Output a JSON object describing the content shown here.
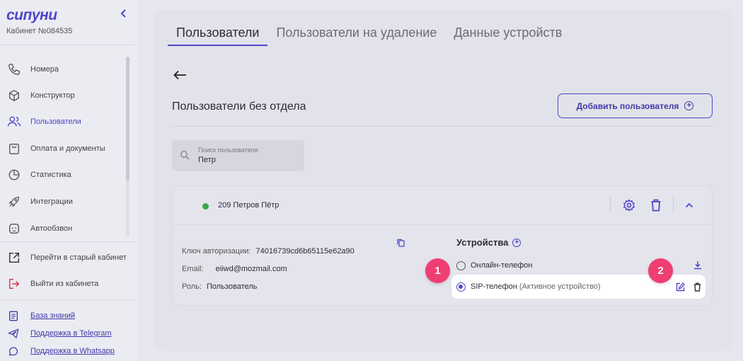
{
  "sidebar": {
    "logo": "сипуни",
    "cabinet": "Кабинет №084535",
    "items": [
      {
        "label": "Номера",
        "icon": "phone-icon"
      },
      {
        "label": "Конструктор",
        "icon": "cube-icon"
      },
      {
        "label": "Пользователи",
        "icon": "users-icon",
        "active": true
      },
      {
        "label": "Оплата и документы",
        "icon": "bag-icon"
      },
      {
        "label": "Статистика",
        "icon": "pie-chart-icon"
      },
      {
        "label": "Интеграции",
        "icon": "rocket-icon"
      },
      {
        "label": "Автообзвон",
        "icon": "robot-icon"
      }
    ],
    "old_cabinet": "Перейти в старый кабинет",
    "logout": "Выйти из кабинета",
    "links": [
      {
        "label": "База знаний",
        "icon": "clipboard-icon"
      },
      {
        "label": "Поддержка в Telegram",
        "icon": "telegram-icon"
      },
      {
        "label": "Поддержка в Whatsapp",
        "icon": "whatsapp-icon"
      }
    ]
  },
  "tabs": [
    {
      "label": "Пользователи",
      "active": true
    },
    {
      "label": "Пользователи на удаление"
    },
    {
      "label": "Данные устройств"
    }
  ],
  "page": {
    "title": "Пользователи без отдела",
    "add_button": "Добавить пользователя"
  },
  "search": {
    "placeholder": "Поиск пользователя",
    "value": "Петр"
  },
  "user": {
    "name": "209 Петров Пётр",
    "status": "online",
    "auth_key_label": "Ключ авторизации:",
    "auth_key": "74016739cd6b65115e62a90",
    "email_label": "Email:",
    "email": "eiiwd@mozmail.com",
    "role_label": "Роль:",
    "role": "Пользователь"
  },
  "devices": {
    "title": "Устройства",
    "list": [
      {
        "name": "Онлайн-телефон",
        "note": "",
        "selected": false
      },
      {
        "name": "SIP-телефон",
        "note": "(Активное устройство)",
        "selected": true
      }
    ]
  },
  "markers": [
    "1",
    "2"
  ],
  "colors": {
    "accent": "#4f46c8",
    "marker": "#ef3e72",
    "online": "#3aa64a"
  }
}
